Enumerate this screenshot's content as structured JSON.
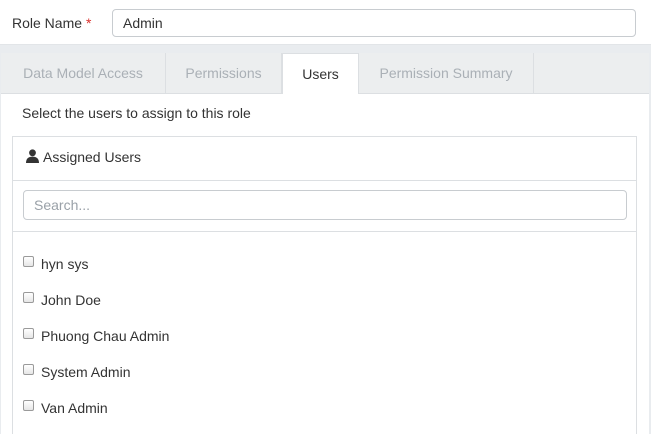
{
  "role": {
    "label": "Role Name",
    "required_mark": "*",
    "value": "Admin"
  },
  "tabs": [
    {
      "label": "Data Model Access",
      "active": false
    },
    {
      "label": "Permissions",
      "active": false
    },
    {
      "label": "Users",
      "active": true
    },
    {
      "label": "Permission Summary",
      "active": false
    }
  ],
  "panel": {
    "instruction": "Select the users to assign to this role",
    "header_icon": "user-icon",
    "header_title": "Assigned Users",
    "search_placeholder": "Search...",
    "users": [
      {
        "name": "hyn sys",
        "checked": false
      },
      {
        "name": "John Doe",
        "checked": false
      },
      {
        "name": "Phuong Chau Admin",
        "checked": false
      },
      {
        "name": "System Admin",
        "checked": false
      },
      {
        "name": "Van Admin",
        "checked": false
      }
    ]
  },
  "colors": {
    "required": "#d9302c",
    "inactive_tab_text": "#aab0b6",
    "border": "#dcdfe2"
  }
}
